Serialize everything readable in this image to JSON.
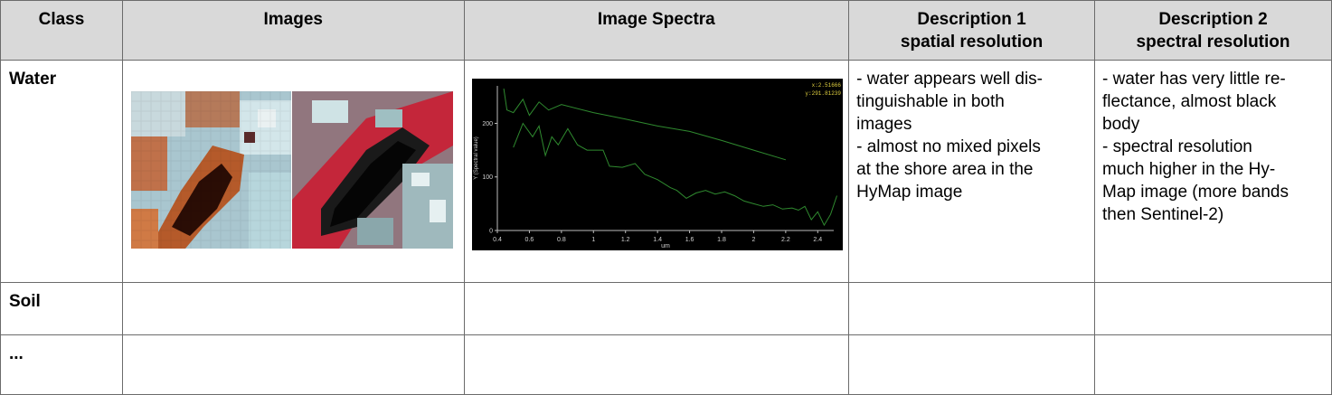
{
  "table": {
    "headers": {
      "class": "Class",
      "images": "Images",
      "spectra": "Image Spectra",
      "desc1_line1": "Description 1",
      "desc1_line2": "spatial resolution",
      "desc2_line1": "Description 2",
      "desc2_line2": "spectral resolution"
    },
    "rows": [
      {
        "class": "Water",
        "desc1": [
          "- water appears well dis-",
          "tinguishable in both",
          "images",
          "- almost no mixed pixels",
          "at the shore area in the",
          "HyMap image"
        ],
        "desc2": [
          "- water has very little re-",
          "flectance, almost black",
          "body",
          "- spectral resolution",
          "much higher in the Hy-",
          "Map image (more bands",
          "then Sentinel-2)"
        ]
      },
      {
        "class": "Soil"
      },
      {
        "class": "..."
      }
    ]
  },
  "chart_data": {
    "type": "line",
    "xlabel": "um",
    "ylabel": "Y (Spectral value)",
    "xlim": [
      0.4,
      2.5
    ],
    "ylim": [
      0,
      270
    ],
    "x_ticks": [
      "0.4",
      "0.6",
      "0.8",
      "1",
      "1.2",
      "1.4",
      "1.6",
      "1.8",
      "2",
      "2.2",
      "2.4"
    ],
    "y_ticks": [
      "0",
      "100",
      "200"
    ],
    "cursor_readout": [
      "x:2.51666",
      "y:291.81239"
    ],
    "line_color": "#2f8a2f",
    "series": [
      {
        "x": [
          0.44,
          0.46,
          0.5,
          0.56,
          0.6,
          0.66,
          0.72,
          0.8,
          1.0,
          1.2,
          1.4,
          1.6,
          1.8,
          2.0,
          2.2
        ],
        "values": [
          265,
          225,
          220,
          245,
          215,
          240,
          225,
          235,
          220,
          208,
          195,
          185,
          168,
          150,
          132
        ]
      },
      {
        "x": [
          0.5,
          0.56,
          0.62,
          0.66,
          0.7,
          0.74,
          0.78,
          0.84,
          0.9,
          0.96,
          1.0,
          1.06,
          1.1,
          1.18,
          1.26,
          1.32,
          1.4,
          1.48,
          1.52,
          1.58,
          1.64,
          1.7,
          1.76,
          1.82,
          1.88,
          1.94,
          2.0,
          2.06,
          2.12,
          2.18,
          2.24,
          2.28,
          2.32,
          2.36,
          2.4,
          2.44,
          2.48,
          2.52
        ],
        "values": [
          155,
          200,
          175,
          195,
          140,
          175,
          160,
          190,
          160,
          150,
          150,
          150,
          120,
          118,
          125,
          105,
          95,
          80,
          75,
          60,
          70,
          75,
          68,
          72,
          65,
          55,
          50,
          45,
          48,
          40,
          42,
          38,
          45,
          20,
          35,
          10,
          30,
          65
        ]
      }
    ]
  }
}
